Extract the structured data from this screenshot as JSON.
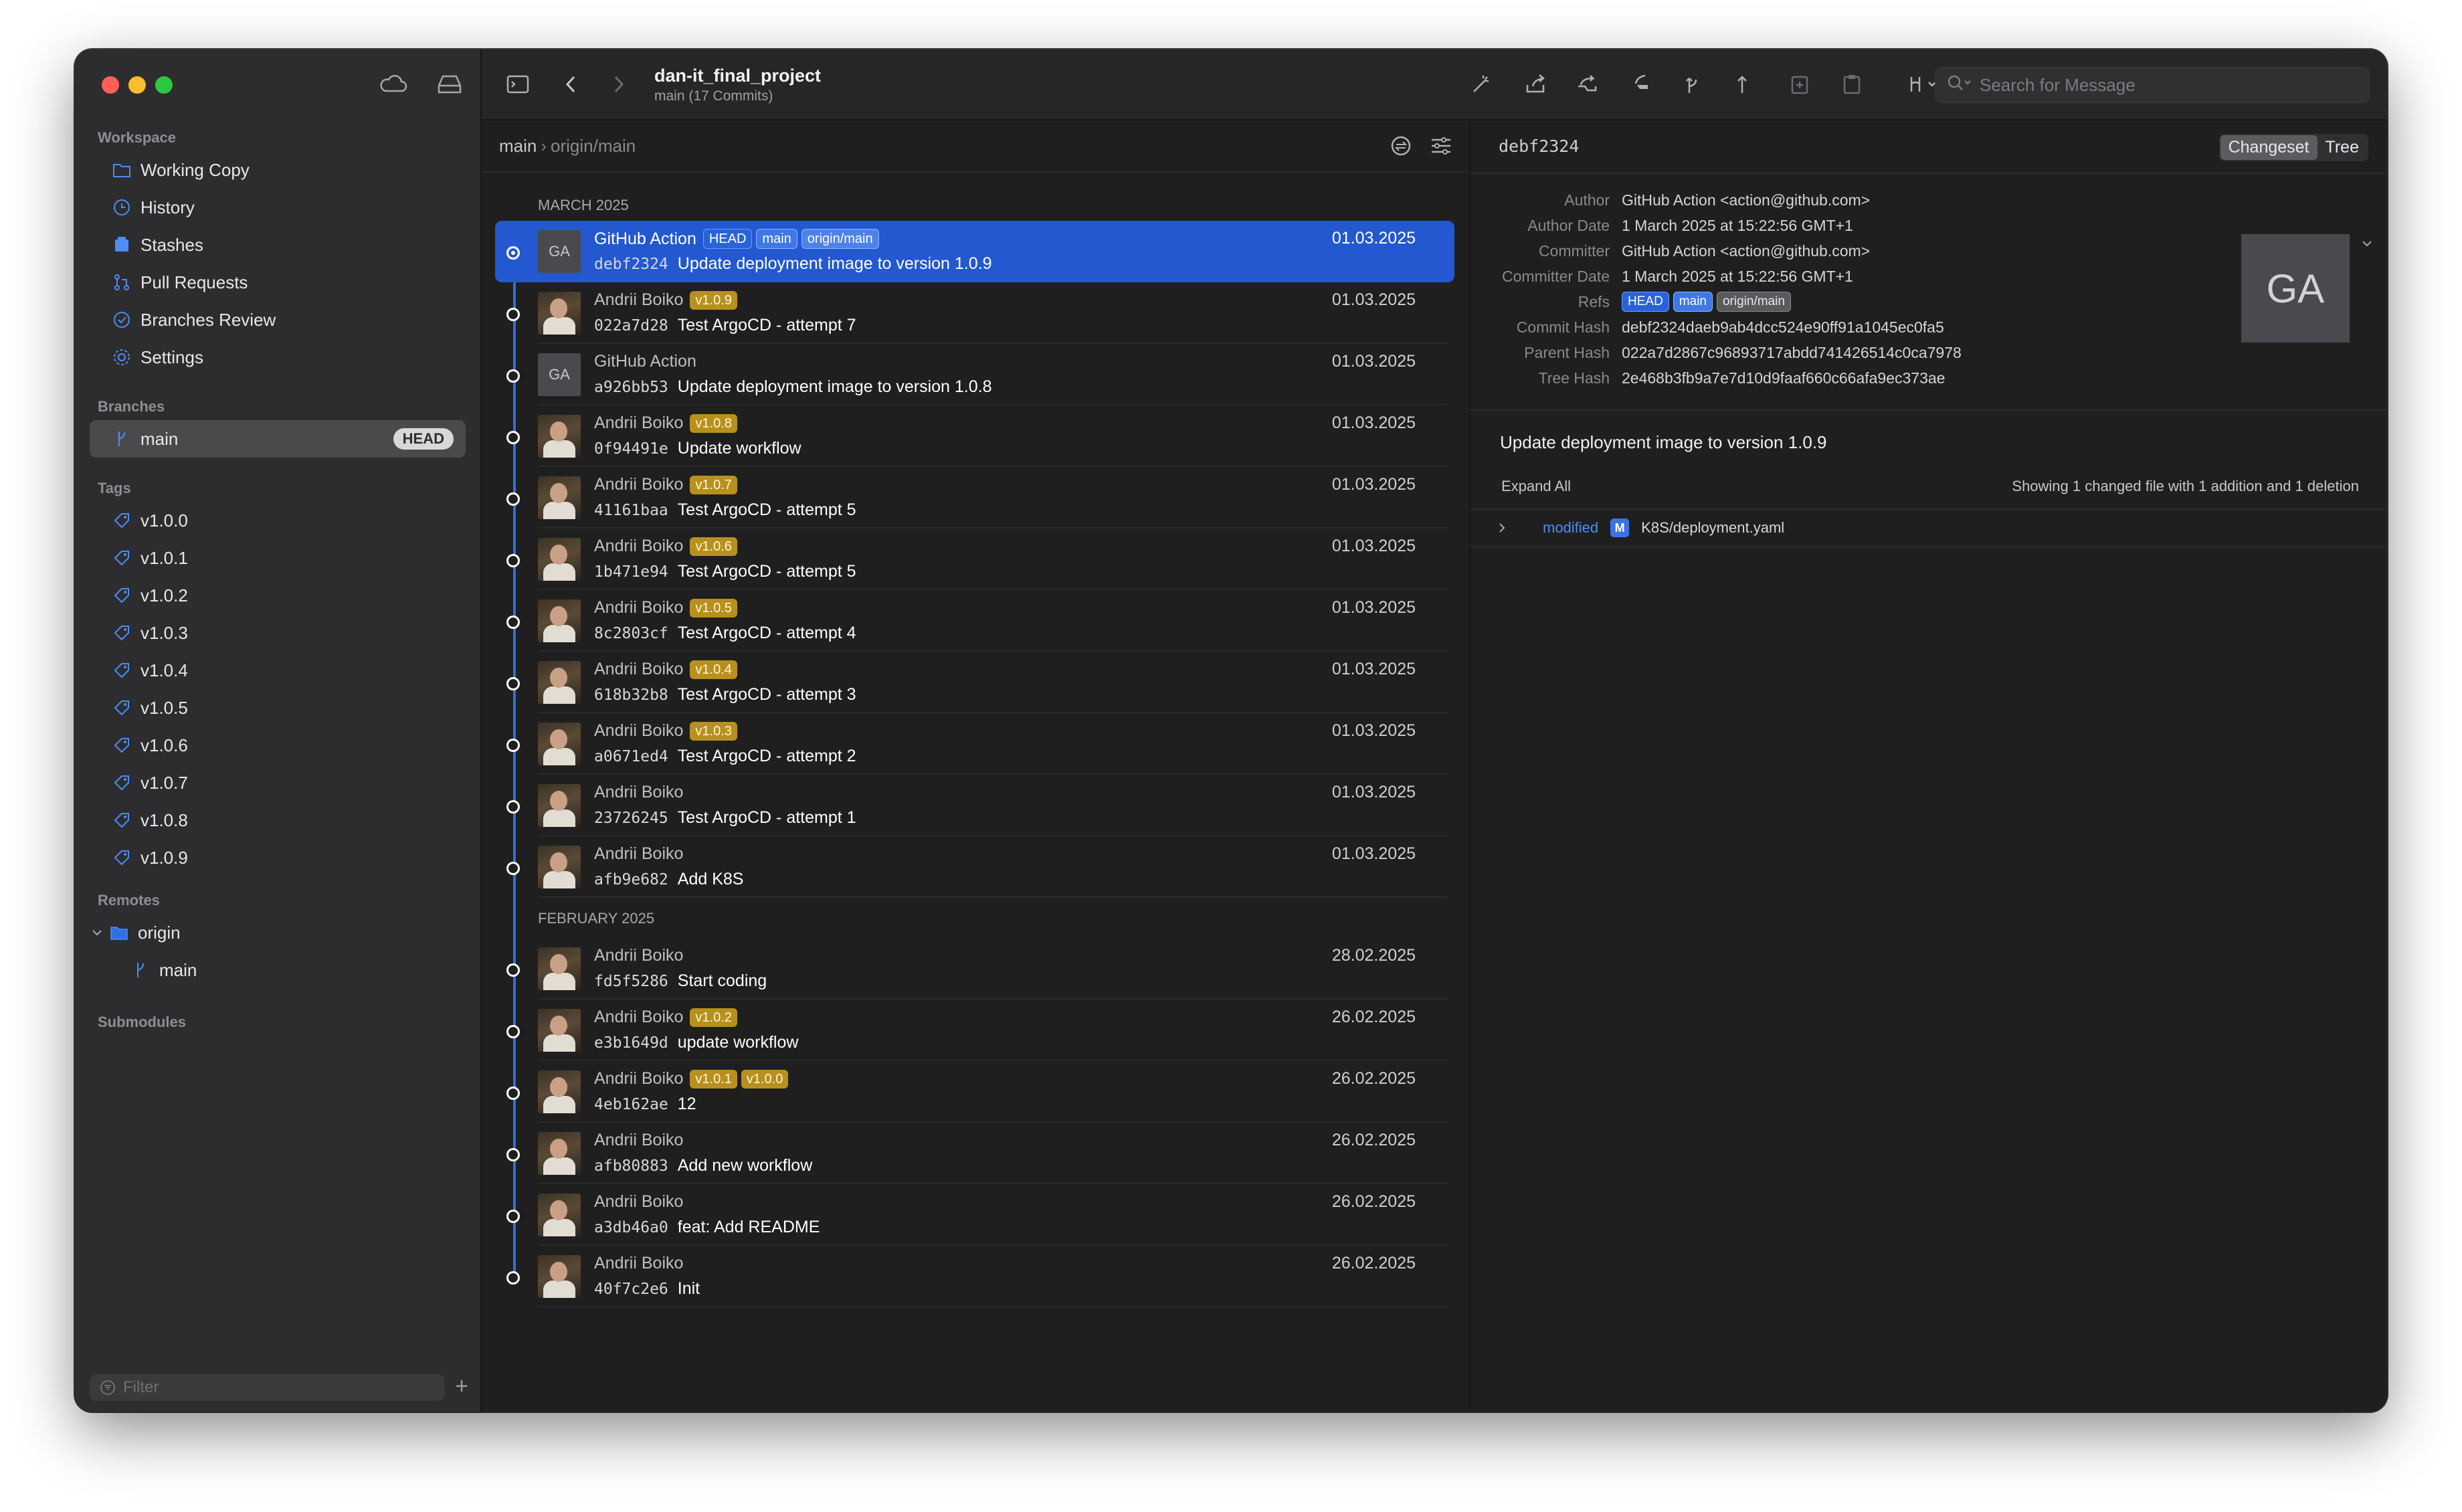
{
  "sidebar": {
    "workspace_label": "Workspace",
    "workspace_items": [
      {
        "label": "Working Copy",
        "icon": "folder-icon"
      },
      {
        "label": "History",
        "icon": "clock-icon"
      },
      {
        "label": "Stashes",
        "icon": "stash-icon"
      },
      {
        "label": "Pull Requests",
        "icon": "pull-request-icon"
      },
      {
        "label": "Branches Review",
        "icon": "review-icon"
      },
      {
        "label": "Settings",
        "icon": "gear-icon"
      }
    ],
    "branches_label": "Branches",
    "branch_main": "main",
    "branch_head": "HEAD",
    "tags_label": "Tags",
    "tags": [
      "v1.0.0",
      "v1.0.1",
      "v1.0.2",
      "v1.0.3",
      "v1.0.4",
      "v1.0.5",
      "v1.0.6",
      "v1.0.7",
      "v1.0.8",
      "v1.0.9"
    ],
    "remotes_label": "Remotes",
    "remote_origin": "origin",
    "remote_main": "main",
    "submodules_label": "Submodules",
    "filter_placeholder": "Filter",
    "add_label": "+"
  },
  "toolbar": {
    "project_title": "dan-it_final_project",
    "project_subtitle": "main (17 Commits)",
    "search_placeholder": "Search for Message"
  },
  "commit_list": {
    "breadcrumb_branch": "main",
    "breadcrumb_remote": "origin/main",
    "month_march": "MARCH 2025",
    "month_february": "FEBRUARY 2025",
    "commits": [
      {
        "author": "GitHub Action",
        "hash": "debf2324",
        "subject": "Update deployment image to version 1.0.9",
        "date": "01.03.2025",
        "avatar": "GA",
        "refs": [
          "HEAD",
          "main",
          "origin/main"
        ],
        "tags": []
      },
      {
        "author": "Andrii Boiko",
        "hash": "022a7d28",
        "subject": "Test ArgoCD - attempt 7",
        "date": "01.03.2025",
        "avatar": "",
        "refs": [],
        "tags": [
          "v1.0.9"
        ]
      },
      {
        "author": "GitHub Action",
        "hash": "a926bb53",
        "subject": "Update deployment image to version 1.0.8",
        "date": "01.03.2025",
        "avatar": "GA",
        "refs": [],
        "tags": []
      },
      {
        "author": "Andrii Boiko",
        "hash": "0f94491e",
        "subject": "Update workflow",
        "date": "01.03.2025",
        "avatar": "",
        "refs": [],
        "tags": [
          "v1.0.8"
        ]
      },
      {
        "author": "Andrii Boiko",
        "hash": "41161baa",
        "subject": "Test ArgoCD - attempt 5",
        "date": "01.03.2025",
        "avatar": "",
        "refs": [],
        "tags": [
          "v1.0.7"
        ]
      },
      {
        "author": "Andrii Boiko",
        "hash": "1b471e94",
        "subject": "Test ArgoCD - attempt 5",
        "date": "01.03.2025",
        "avatar": "",
        "refs": [],
        "tags": [
          "v1.0.6"
        ]
      },
      {
        "author": "Andrii Boiko",
        "hash": "8c2803cf",
        "subject": "Test ArgoCD - attempt 4",
        "date": "01.03.2025",
        "avatar": "",
        "refs": [],
        "tags": [
          "v1.0.5"
        ]
      },
      {
        "author": "Andrii Boiko",
        "hash": "618b32b8",
        "subject": "Test ArgoCD - attempt 3",
        "date": "01.03.2025",
        "avatar": "",
        "refs": [],
        "tags": [
          "v1.0.4"
        ]
      },
      {
        "author": "Andrii Boiko",
        "hash": "a0671ed4",
        "subject": "Test ArgoCD - attempt 2",
        "date": "01.03.2025",
        "avatar": "",
        "refs": [],
        "tags": [
          "v1.0.3"
        ]
      },
      {
        "author": "Andrii Boiko",
        "hash": "23726245",
        "subject": "Test ArgoCD - attempt 1",
        "date": "01.03.2025",
        "avatar": "",
        "refs": [],
        "tags": []
      },
      {
        "author": "Andrii Boiko",
        "hash": "afb9e682",
        "subject": "Add K8S",
        "date": "01.03.2025",
        "avatar": "",
        "refs": [],
        "tags": []
      },
      {
        "author": "Andrii Boiko",
        "hash": "fd5f5286",
        "subject": "Start coding",
        "date": "28.02.2025",
        "avatar": "",
        "refs": [],
        "tags": []
      },
      {
        "author": "Andrii Boiko",
        "hash": "e3b1649d",
        "subject": "update workflow",
        "date": "26.02.2025",
        "avatar": "",
        "refs": [],
        "tags": [
          "v1.0.2"
        ]
      },
      {
        "author": "Andrii Boiko",
        "hash": "4eb162ae",
        "subject": "12",
        "date": "26.02.2025",
        "avatar": "",
        "refs": [],
        "tags": [
          "v1.0.1",
          "v1.0.0"
        ]
      },
      {
        "author": "Andrii Boiko",
        "hash": "afb80883",
        "subject": "Add new workflow",
        "date": "26.02.2025",
        "avatar": "",
        "refs": [],
        "tags": []
      },
      {
        "author": "Andrii Boiko",
        "hash": "a3db46a0",
        "subject": "feat: Add README",
        "date": "26.02.2025",
        "avatar": "",
        "refs": [],
        "tags": []
      },
      {
        "author": "Andrii Boiko",
        "hash": "40f7c2e6",
        "subject": "Init",
        "date": "26.02.2025",
        "avatar": "",
        "refs": [],
        "tags": []
      }
    ]
  },
  "details": {
    "hash_short": "debf2324",
    "tab_changeset": "Changeset",
    "tab_tree": "Tree",
    "author_label": "Author",
    "author_value": "GitHub Action <action@github.com>",
    "author_date_label": "Author Date",
    "author_date_value": "1 March 2025 at 15:22:56 GMT+1",
    "committer_label": "Committer",
    "committer_value": "GitHub Action <action@github.com>",
    "committer_date_label": "Committer Date",
    "committer_date_value": "1 March 2025 at 15:22:56 GMT+1",
    "refs_label": "Refs",
    "refs": [
      "HEAD",
      "main",
      "origin/main"
    ],
    "commit_hash_label": "Commit Hash",
    "commit_hash_value": "debf2324daeb9ab4dcc524e90ff91a1045ec0fa5",
    "parent_hash_label": "Parent Hash",
    "parent_hash_value": "022a7d2867c96893717abdd741426514c0ca7978",
    "tree_hash_label": "Tree Hash",
    "tree_hash_value": "2e468b3fb9a7e7d10d9faaf660c66afa9ec373ae",
    "avatar_initials": "GA",
    "message": "Update deployment image to version 1.0.9",
    "expand_all": "Expand All",
    "summary": "Showing 1 changed file with 1 addition and 1 deletion",
    "file_status": "modified",
    "file_badge": "M",
    "file_name": "K8S/deployment.yaml"
  },
  "colors": {
    "accent": "#2358d0",
    "tag": "#b8901e",
    "graph": "#2f6fe0"
  }
}
